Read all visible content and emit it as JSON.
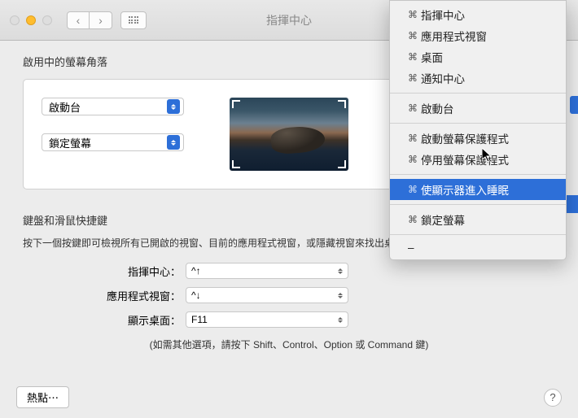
{
  "window": {
    "title": "指揮中心"
  },
  "hotcorners": {
    "section_label": "啟用中的螢幕角落",
    "top_left": "啟動台",
    "bottom_left": "鎖定螢幕",
    "top_right": "",
    "bottom_right": ""
  },
  "menu": {
    "items": [
      {
        "label": "指揮中心",
        "mod": "⌘"
      },
      {
        "label": "應用程式視窗",
        "mod": "⌘"
      },
      {
        "label": "桌面",
        "mod": "⌘"
      },
      {
        "label": "通知中心",
        "mod": "⌘"
      }
    ],
    "group2": [
      {
        "label": "啟動台",
        "mod": "⌘"
      }
    ],
    "group3": [
      {
        "label": "啟動螢幕保護程式",
        "mod": "⌘"
      },
      {
        "label": "停用螢幕保護程式",
        "mod": "⌘"
      }
    ],
    "highlighted": {
      "label": "使顯示器進入睡眠",
      "mod": "⌘"
    },
    "group4": [
      {
        "label": "鎖定螢幕",
        "mod": "⌘"
      }
    ],
    "dash": "–"
  },
  "keyboard": {
    "section_label": "鍵盤和滑鼠快捷鍵",
    "description": "按下一個按鍵即可檢視所有已開啟的視窗、目前的應用程式視窗，或隱藏視窗來找出桌面上可能被遮住的項目。",
    "rows": [
      {
        "label": "指揮中心：",
        "value": "^↑"
      },
      {
        "label": "應用程式視窗：",
        "value": "^↓"
      },
      {
        "label": "顯示桌面：",
        "value": "F11"
      }
    ],
    "hint": "(如需其他選項，請按下 Shift、Control、Option 或 Command 鍵)"
  },
  "footer": {
    "hotcorners_btn": "熱點⋯",
    "help": "?"
  }
}
